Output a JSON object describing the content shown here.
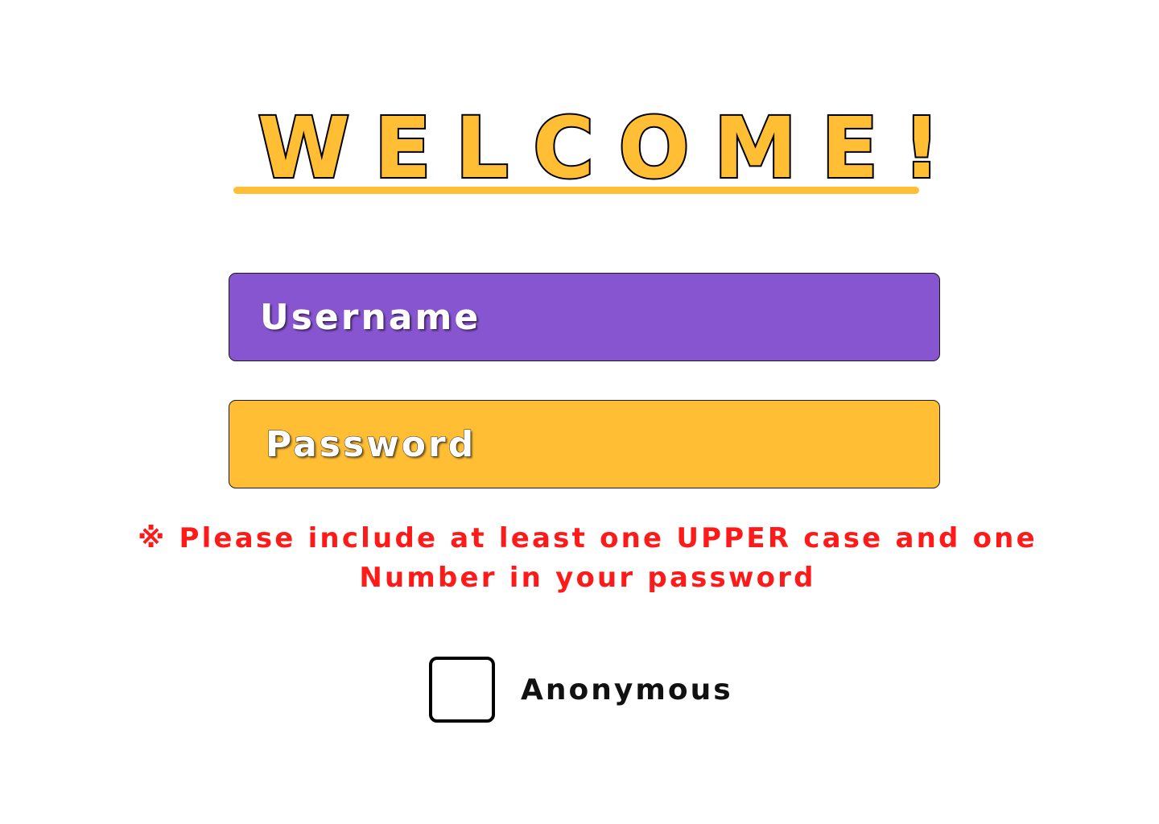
{
  "header": {
    "title": "WELCOME!"
  },
  "form": {
    "username_placeholder": "Username",
    "password_placeholder": "Password",
    "password_hint": "※ Please include at least one UPPER case and one Number in your password",
    "anonymous_label": "Anonymous",
    "anonymous_checked": false
  },
  "colors": {
    "accent_yellow": "#FFBE33",
    "username_field": "#8855D0",
    "hint_red": "#FF1A1A"
  }
}
